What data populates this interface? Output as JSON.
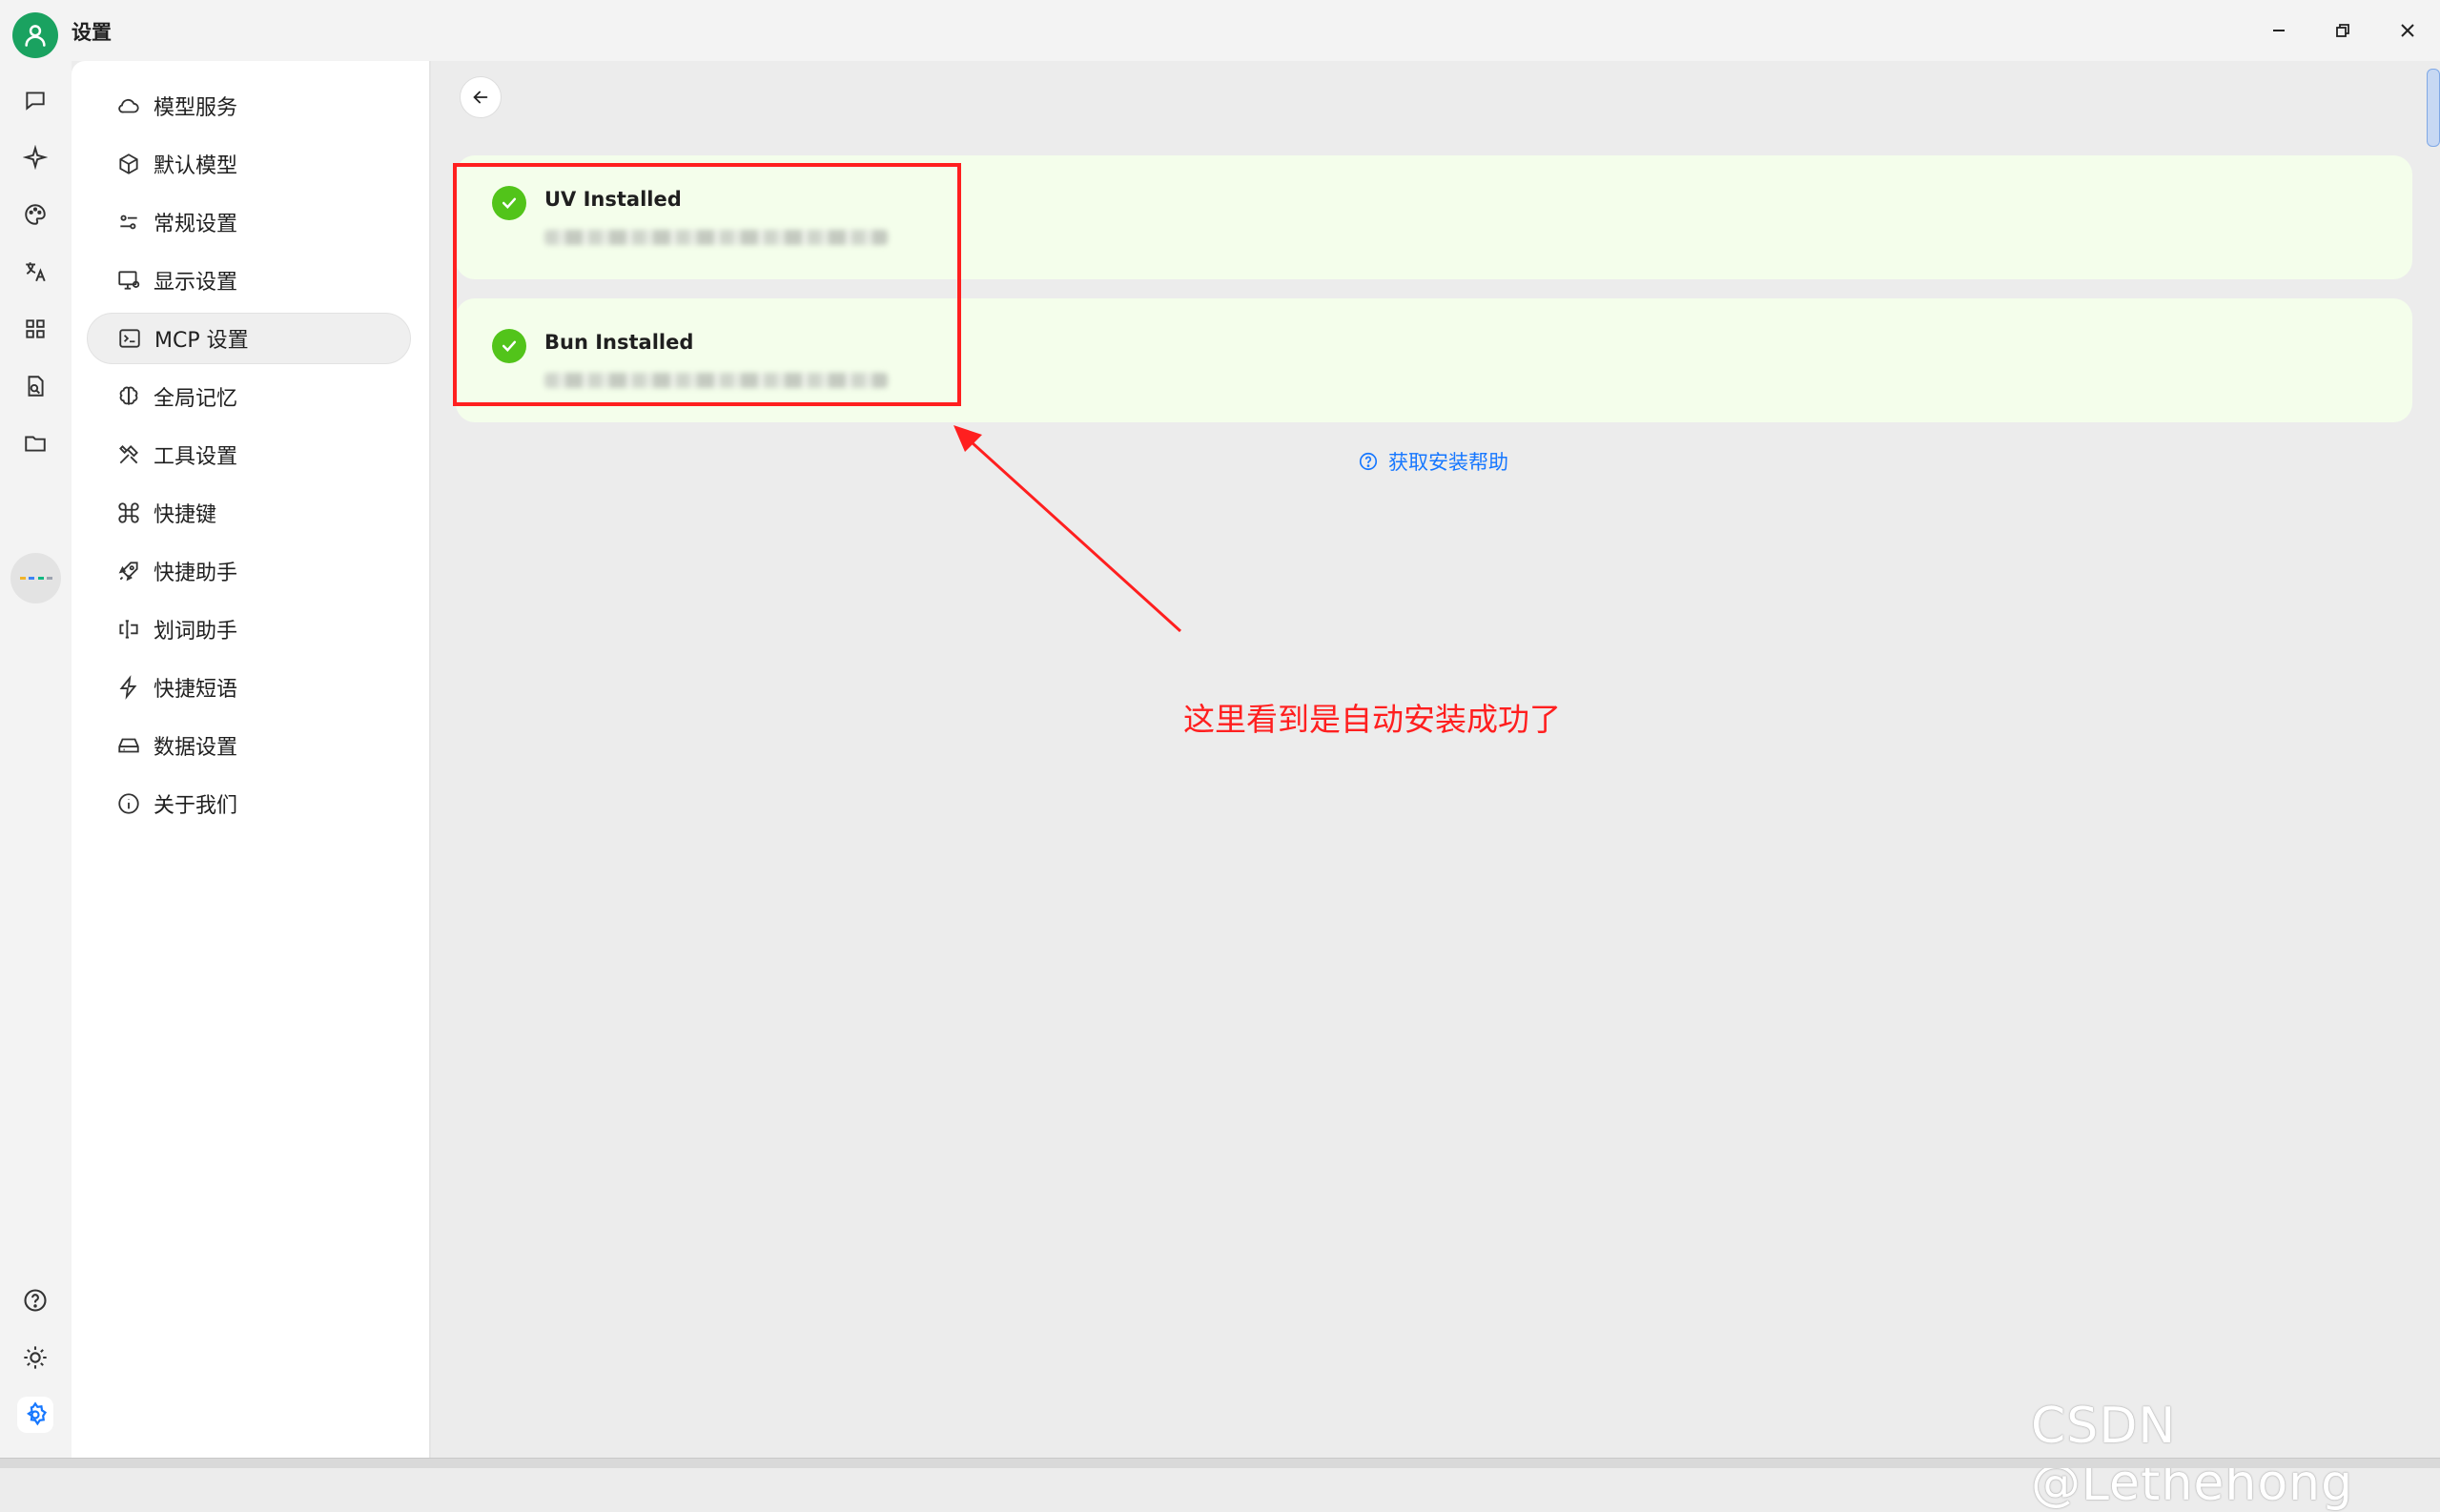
{
  "window": {
    "title": "设置",
    "minimize_icon": "minimize-icon",
    "restore_icon": "restore-icon",
    "close_icon": "close-icon"
  },
  "rail": {
    "items": [
      "chat-icon",
      "sparkle-icon",
      "palette-icon",
      "translate-icon",
      "apps-grid-icon",
      "document-search-icon",
      "folder-icon",
      "mini-app-icon"
    ],
    "bottom": [
      "help-icon",
      "theme-sun-icon",
      "settings-gear-icon"
    ]
  },
  "nav": {
    "items": [
      {
        "label": "模型服务",
        "icon": "cloud-icon"
      },
      {
        "label": "默认模型",
        "icon": "cube-icon"
      },
      {
        "label": "常规设置",
        "icon": "sliders-icon"
      },
      {
        "label": "显示设置",
        "icon": "monitor-icon"
      },
      {
        "label": "MCP 设置",
        "icon": "terminal-icon",
        "active": true
      },
      {
        "label": "全局记忆",
        "icon": "brain-icon"
      },
      {
        "label": "工具设置",
        "icon": "tools-icon"
      },
      {
        "label": "快捷键",
        "icon": "command-icon"
      },
      {
        "label": "快捷助手",
        "icon": "rocket-icon"
      },
      {
        "label": "划词助手",
        "icon": "text-cursor-icon"
      },
      {
        "label": "快捷短语",
        "icon": "zap-icon"
      },
      {
        "label": "数据设置",
        "icon": "hard-drive-icon"
      },
      {
        "label": "关于我们",
        "icon": "info-icon"
      }
    ]
  },
  "content": {
    "cards": [
      {
        "title": "UV Installed"
      },
      {
        "title": "Bun Installed"
      }
    ],
    "help_link": "获取安装帮助"
  },
  "annotation": {
    "text": "这里看到是自动安装成功了",
    "color": "#ff1f1f"
  },
  "watermark": "CSDN @Lethehong",
  "colors": {
    "accent": "#1677ff",
    "success": "#52c41a",
    "card_bg": "#f4feeb",
    "brand": "#1aa260"
  }
}
